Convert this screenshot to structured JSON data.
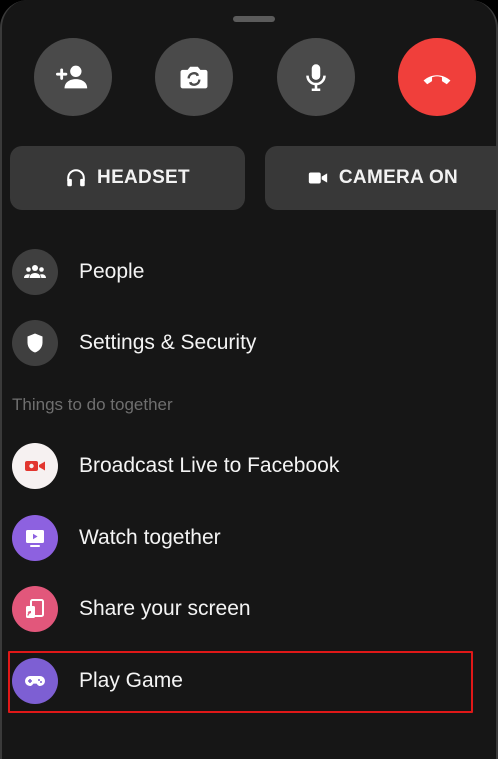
{
  "controls": {
    "add_person_icon": "person-add-icon",
    "flip_camera_icon": "camera-flip-icon",
    "mic_icon": "mic-icon",
    "end_call_icon": "end-call-icon",
    "end_call_color": "#f03f3b"
  },
  "buttons": {
    "headset": "HEADSET",
    "camera": "CAMERA ON"
  },
  "menu": {
    "people": "People",
    "settings": "Settings & Security",
    "section_title": "Things to do together",
    "broadcast": "Broadcast Live to Facebook",
    "watch": "Watch together",
    "share": "Share your screen",
    "game": "Play Game"
  },
  "colors": {
    "broadcast_bg": "#f6f1f1",
    "broadcast_icon": "#e2362f",
    "watch_bg": "#8d61e0",
    "share_bg": "#e2577b",
    "game_bg": "#7d5fd3",
    "highlight": "#e01818"
  }
}
